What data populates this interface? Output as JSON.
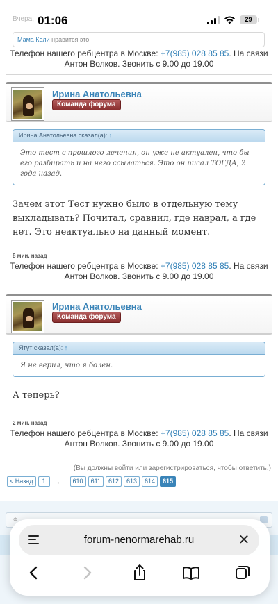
{
  "status_bar": {
    "prev_label": "Вчера,",
    "time": "01:06",
    "battery": "29"
  },
  "likes": {
    "liker": "Мама Коли",
    "text": "нравится это."
  },
  "signature": {
    "prefix": "Телефон нашего ребцентра в Москве:",
    "phone": "+7(985) 028 85 85",
    "suffix": ". На связи",
    "line2": "Антон Волков. Звонить с 9.00 до 19.00"
  },
  "posts": [
    {
      "username": "Ирина Анатольевна",
      "rank": "Команда форума",
      "quote_header": "Ирина Анатольевна сказал(а):",
      "quote_arrow": "↑",
      "quote_text": "Это тест с прошлого лечения, он уже не актуален, что бы его разбирать и на него ссылаться. Это он писал ТОГДА, 2 года назад.",
      "text": "Зачем этот Тест нужно было в отдельную тему выкладывать? Почитал, сравнил, где наврал, а где нет. Это неактуально на данный момент.",
      "time": "8 мин. назад"
    },
    {
      "username": "Ирина Анатольевна",
      "rank": "Команда форума",
      "quote_header": "Ятут сказал(а):",
      "quote_arrow": "↑",
      "quote_text": "Я не верил, что я болен.",
      "text": "А теперь?",
      "time": "2 мин. назад"
    }
  ],
  "login_note": "(Вы должны войти или зарегистрироваться, чтобы ответить.)",
  "pagination": {
    "prev": "< Назад",
    "first": "1",
    "separator": "←",
    "pages": [
      "610",
      "611",
      "612",
      "613",
      "614"
    ],
    "current": "615"
  },
  "reply_box": {
    "placeholder_initial": "Ф"
  },
  "browser": {
    "url": "forum-nenormarehab.ru",
    "icons": {
      "tabs_left": "page-menu-icon",
      "close": "close-icon",
      "back": "back-chevron-icon",
      "forward": "forward-chevron-icon",
      "share": "share-icon",
      "bookmarks": "book-icon",
      "tabs": "tabs-icon"
    }
  }
}
